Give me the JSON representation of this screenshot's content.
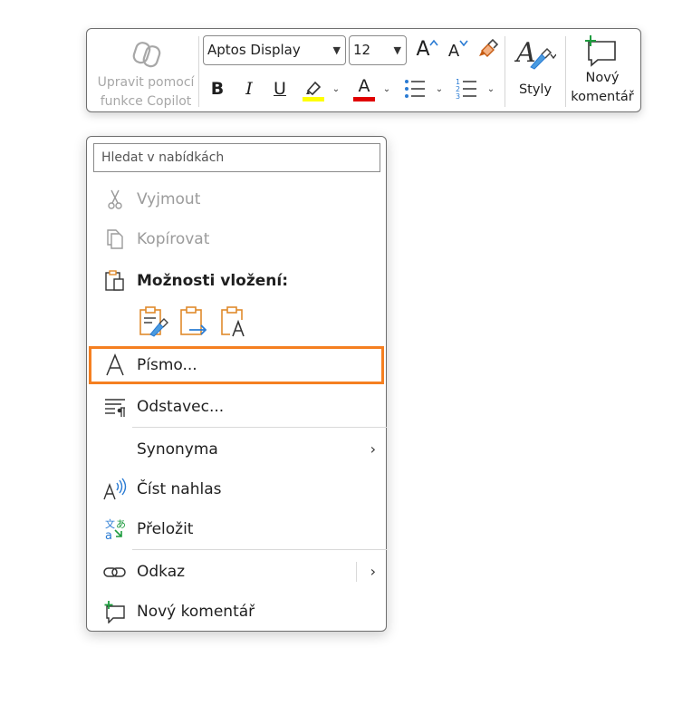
{
  "toolbar": {
    "copilot": {
      "line1": "Upravit pomocí",
      "line2": "funkce Copilot",
      "icon": "copilot-icon"
    },
    "font_name": {
      "value": "Aptos Display",
      "options": [
        "Aptos Display"
      ]
    },
    "font_size": {
      "value": "12",
      "options": [
        "12"
      ]
    },
    "grow_font": "A",
    "shrink_font": "A",
    "bold": "B",
    "italic": "I",
    "underline": "U",
    "font_color_letter": "A",
    "colors": {
      "highlight": "#ffff00",
      "font_color": "#e00000",
      "accent_green": "#1e9c3f",
      "accent_blue": "#2a7bd3",
      "accent_orange": "#e08a2c"
    },
    "styles_label": "Styly",
    "new_comment": {
      "line1": "Nový",
      "line2": "komentář"
    }
  },
  "menu": {
    "search_placeholder": "Hledat v nabídkách",
    "items": {
      "cut": {
        "label": "Vyjmout",
        "icon": "scissors-icon",
        "disabled": true
      },
      "copy": {
        "label": "Kopírovat",
        "icon": "copy-icon",
        "disabled": true
      },
      "paste_options": {
        "label": "Možnosti vložení:",
        "icon": "paste-icon"
      },
      "font": {
        "label": "Písmo...",
        "icon": "font-icon"
      },
      "paragraph": {
        "label": "Odstavec...",
        "icon": "paragraph-icon"
      },
      "synonyms": {
        "label": "Synonyma",
        "arrow": "›"
      },
      "read_aloud": {
        "label": "Číst nahlas",
        "icon": "read-aloud-icon"
      },
      "translate": {
        "label": "Přeložit",
        "icon": "translate-icon"
      },
      "link": {
        "label": "Odkaz",
        "icon": "link-icon",
        "arrow": "›"
      },
      "new_comment": {
        "label": "Nový komentář",
        "icon": "new-comment-icon"
      }
    },
    "highlight_color": "#f57f20"
  }
}
